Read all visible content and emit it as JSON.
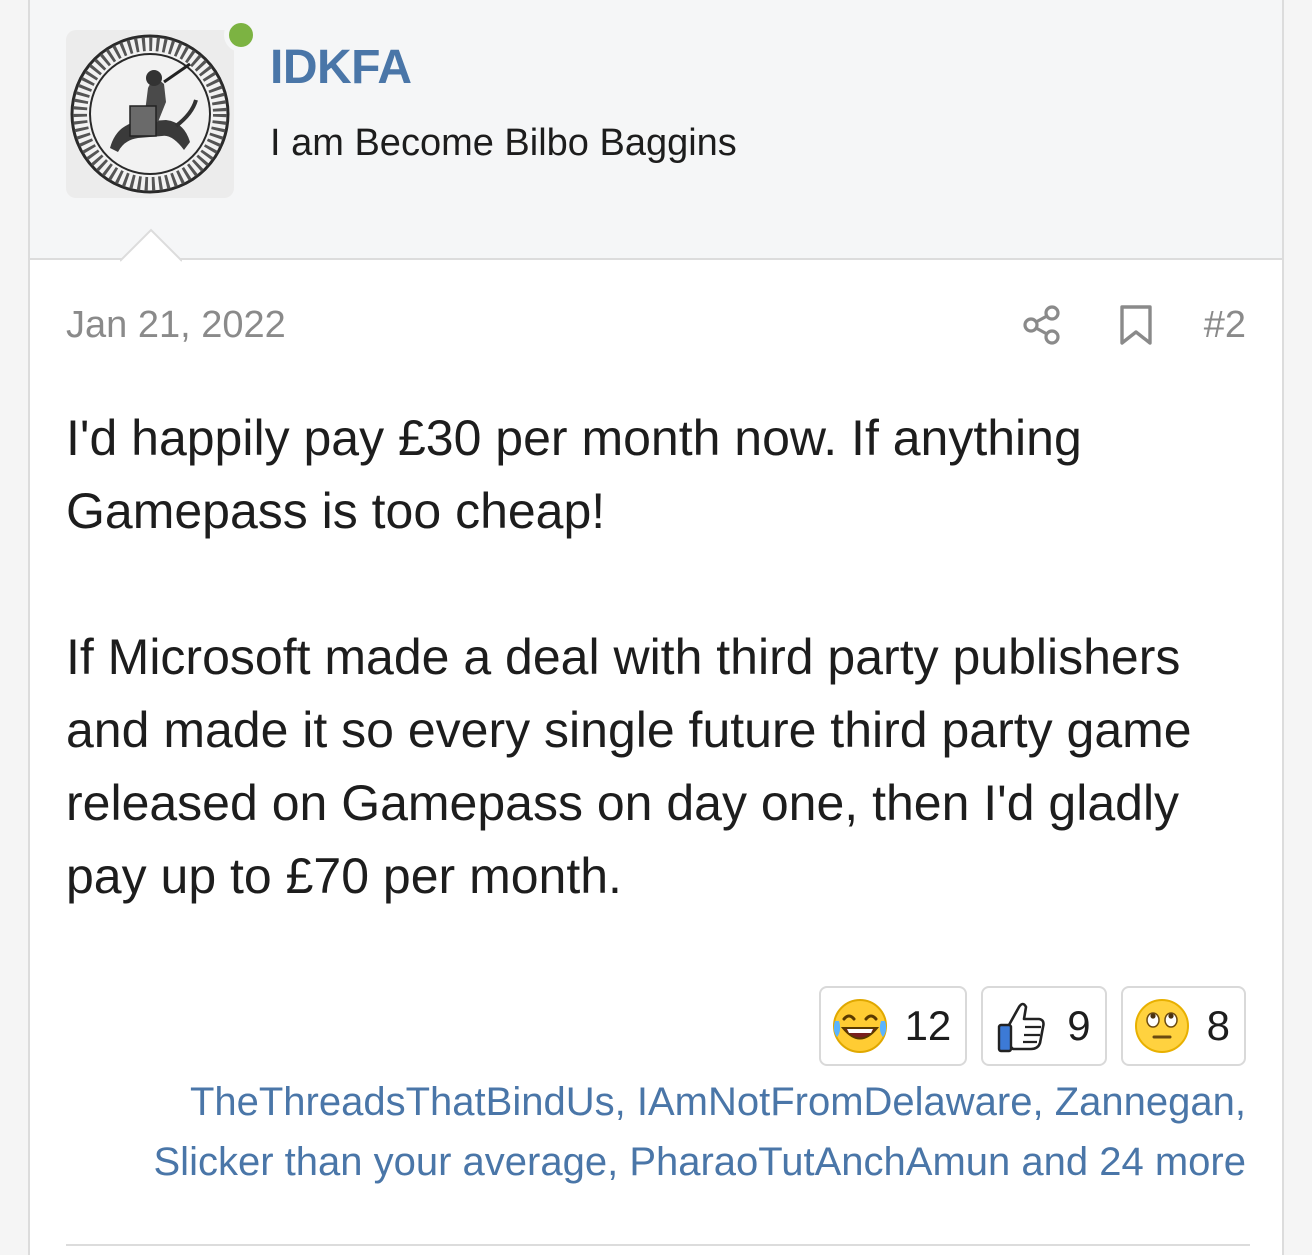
{
  "user": {
    "name": "IDKFA",
    "title": "I am Become Bilbo Baggins",
    "online": true,
    "avatar_icon": "seal-avatar-icon"
  },
  "post": {
    "date": "Jan 21, 2022",
    "number": "#2",
    "share_icon": "share-icon",
    "bookmark_icon": "bookmark-icon",
    "paragraphs": [
      "I'd happily pay £30 per month now. If anything Gamepass is too cheap!",
      "If Microsoft made a deal with third party publishers and made it so every single future third party game released on Gamepass on day one, then I'd gladly pay up to £70 per month."
    ]
  },
  "reactions": [
    {
      "icon": "laughing-emoji-icon",
      "count": "12"
    },
    {
      "icon": "thumbs-up-icon",
      "count": "9"
    },
    {
      "icon": "eye-roll-emoji-icon",
      "count": "8"
    }
  ],
  "reactors": {
    "names": [
      "TheThreadsThatBindUs",
      "IAmNotFromDelaware",
      "Zannegan",
      "Slicker than your average",
      "PharaoTutAnchAmun"
    ],
    "sep": ", ",
    "and_label": " and ",
    "more_label": "24 more"
  },
  "colors": {
    "link": "#4a76a8",
    "online": "#7cb342",
    "muted": "#8a8a8a"
  }
}
